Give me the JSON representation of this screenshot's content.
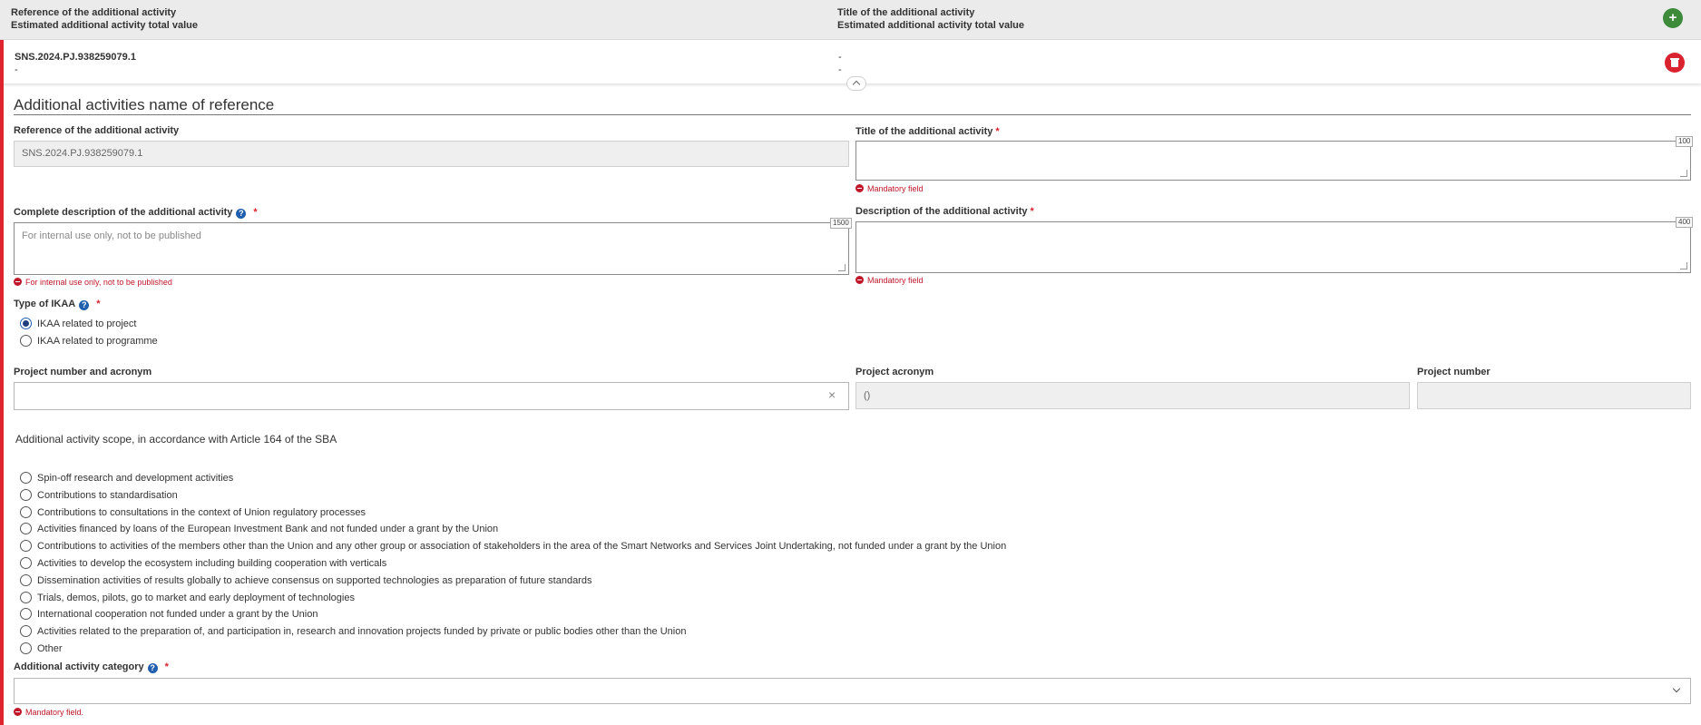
{
  "header": {
    "col1_line1": "Reference of the additional activity",
    "col1_line2": "Estimated additional activity total value",
    "col2_line1": "Title of the additional activity",
    "col2_line2": "Estimated additional activity total value",
    "add_label": "+"
  },
  "record": {
    "reference": "SNS.2024.PJ.938259079.1",
    "value": "-",
    "title": "-",
    "title_value": "-"
  },
  "section": {
    "title": "Additional activities name of reference"
  },
  "form": {
    "reference_label": "Reference of the additional activity",
    "reference_value": "SNS.2024.PJ.938259079.1",
    "title_label": "Title of the additional activity",
    "title_counter": "100",
    "title_error": "Mandatory field",
    "complete_desc_label": "Complete description of the additional activity",
    "complete_desc_placeholder": "For internal use only, not to be published",
    "complete_desc_counter": "1500",
    "complete_desc_error": "For internal use only, not to be published",
    "desc_label": "Description of the additional activity",
    "desc_counter": "400",
    "desc_error": "Mandatory field",
    "required_mark": "*",
    "help_mark": "?",
    "ikaa_label": "Type of IKAA",
    "ikaa_options": [
      "IKAA related to project",
      "IKAA related to programme"
    ],
    "ikaa_selected": 0,
    "project_label": "Project number and acronym",
    "project_value": "",
    "clear_mark": "×",
    "acronym_label": "Project acronym",
    "acronym_value": "()",
    "number_label": "Project number",
    "number_value": "",
    "scope_title": "Additional activity scope, in accordance with Article 164 of the SBA",
    "scope_options": [
      "Spin-off research and development activities",
      "Contributions to standardisation",
      "Contributions to consultations in the context of Union regulatory processes",
      "Activities financed by loans of the European Investment Bank and not funded under a grant by the Union",
      "Contributions to activities of the members other than the Union and any other group or association of stakeholders in the area of the Smart Networks and Services Joint Undertaking, not funded under a grant by the Union",
      "Activities to develop the ecosystem including building cooperation with verticals",
      "Dissemination activities of results globally to achieve consensus on supported technologies as preparation of future standards",
      "Trials, demos, pilots, go to market and early deployment of technologies",
      "International cooperation not funded under a grant by the Union",
      "Activities related to the preparation of, and participation in, research and innovation projects funded by private or public bodies other than the Union",
      "Other"
    ],
    "category_label": "Additional activity category",
    "category_value": "",
    "category_error": "Mandatory field."
  },
  "colors": {
    "accent_red": "#e0242f",
    "add_green": "#3c8a3a",
    "help_blue": "#1f5fae",
    "error_red": "#c0182a"
  }
}
